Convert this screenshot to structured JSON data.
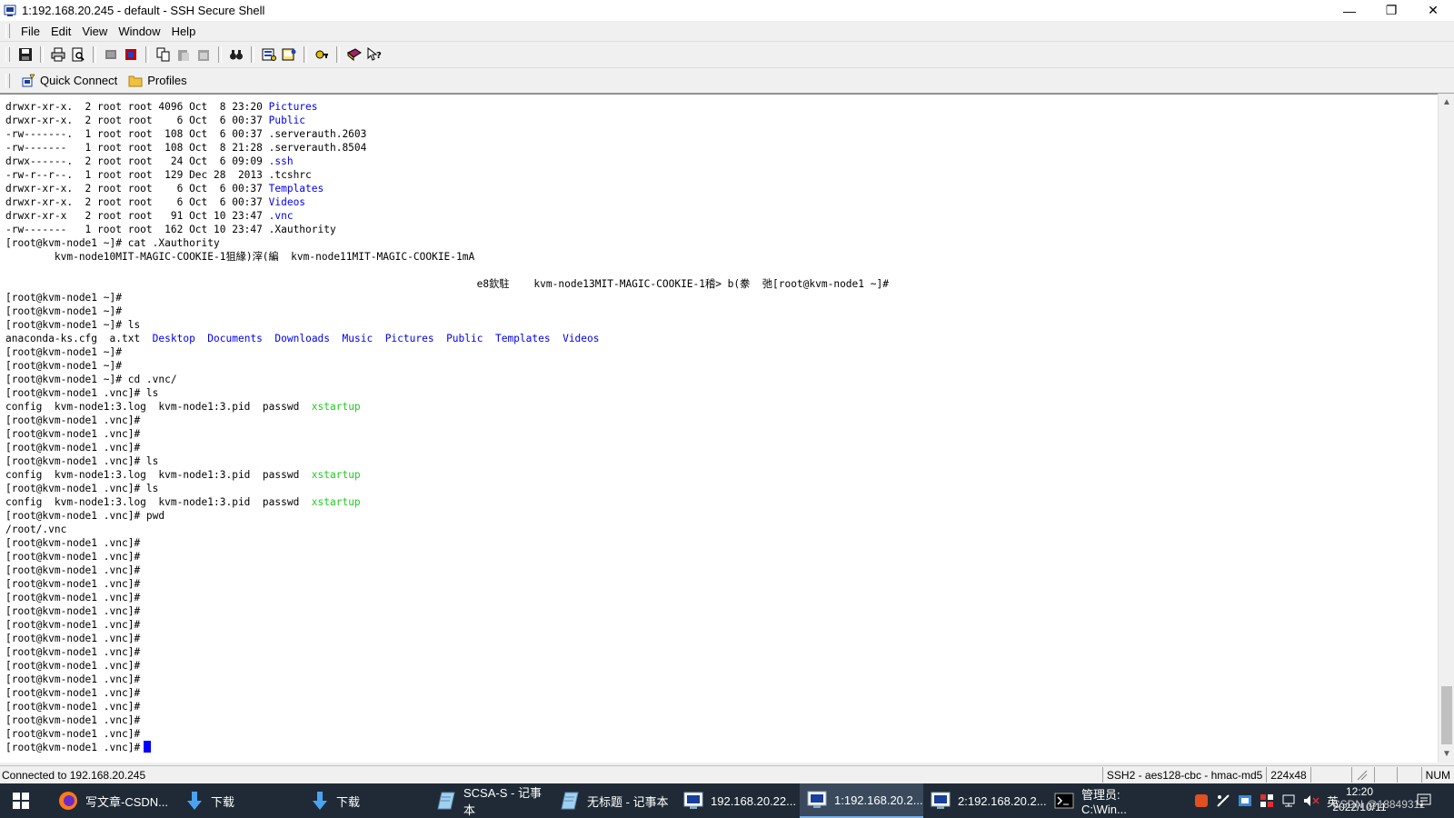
{
  "window": {
    "title": "1:192.168.20.245 - default - SSH Secure Shell",
    "controls": {
      "minimize": "—",
      "restore": "❐",
      "close": "✕"
    }
  },
  "menu": [
    {
      "label": "File",
      "icon": ""
    },
    {
      "label": "Edit"
    },
    {
      "label": "View"
    },
    {
      "label": "Window"
    },
    {
      "label": "Help"
    }
  ],
  "toolbar": {
    "buttons": [
      "save-icon",
      "print-icon",
      "print-preview-icon",
      "new-terminal-icon",
      "new-file-transfer-icon",
      "copy-icon",
      "paste-icon",
      "paste-special-icon",
      "find-icon",
      "settings-icon",
      "profile-icon",
      "keygen-icon",
      "help-book-icon",
      "whats-this-icon"
    ]
  },
  "quickbar": {
    "quick_connect": "Quick Connect",
    "profiles": "Profiles"
  },
  "terminal": {
    "lines": [
      [
        {
          "t": "drwxr-xr-x.  2 root root 4096 Oct  8 23:20 "
        },
        {
          "t": "Pictures",
          "c": "blue"
        }
      ],
      [
        {
          "t": "drwxr-xr-x.  2 root root    6 Oct  6 00:37 "
        },
        {
          "t": "Public",
          "c": "blue"
        }
      ],
      [
        {
          "t": "-rw-------.  1 root root  108 Oct  6 00:37 .serverauth.2603"
        }
      ],
      [
        {
          "t": "-rw-------   1 root root  108 Oct  8 21:28 .serverauth.8504"
        }
      ],
      [
        {
          "t": "drwx------.  2 root root   24 Oct  6 09:09 "
        },
        {
          "t": ".ssh",
          "c": "blue"
        }
      ],
      [
        {
          "t": "-rw-r--r--.  1 root root  129 Dec 28  2013 .tcshrc"
        }
      ],
      [
        {
          "t": "drwxr-xr-x.  2 root root    6 Oct  6 00:37 "
        },
        {
          "t": "Templates",
          "c": "blue"
        }
      ],
      [
        {
          "t": "drwxr-xr-x.  2 root root    6 Oct  6 00:37 "
        },
        {
          "t": "Videos",
          "c": "blue"
        }
      ],
      [
        {
          "t": "drwxr-xr-x   2 root root   91 Oct 10 23:47 "
        },
        {
          "t": ".vnc",
          "c": "blue"
        }
      ],
      [
        {
          "t": "-rw-------   1 root root  162 Oct 10 23:47 .Xauthority"
        }
      ],
      [
        {
          "t": "[root@kvm-node1 ~]# cat .Xauthority"
        }
      ],
      [
        {
          "t": "        kvm-node10MIT-MAGIC-COOKIE-1狙緣)滓(編  kvm-node11MIT-MAGIC-COOKIE-1mA"
        }
      ],
      [
        {
          "t": ""
        }
      ],
      [
        {
          "t": "                                                                             e8欽駐    kvm-node13MIT-MAGIC-COOKIE-1稽> b(豢  弛[root@kvm-node1 ~]#"
        }
      ],
      [
        {
          "t": "[root@kvm-node1 ~]#"
        }
      ],
      [
        {
          "t": "[root@kvm-node1 ~]#"
        }
      ],
      [
        {
          "t": "[root@kvm-node1 ~]# ls"
        }
      ],
      [
        {
          "t": "anaconda-ks.cfg  a.txt  "
        },
        {
          "t": "Desktop",
          "c": "blue"
        },
        {
          "t": "  "
        },
        {
          "t": "Documents",
          "c": "blue"
        },
        {
          "t": "  "
        },
        {
          "t": "Downloads",
          "c": "blue"
        },
        {
          "t": "  "
        },
        {
          "t": "Music",
          "c": "blue"
        },
        {
          "t": "  "
        },
        {
          "t": "Pictures",
          "c": "blue"
        },
        {
          "t": "  "
        },
        {
          "t": "Public",
          "c": "blue"
        },
        {
          "t": "  "
        },
        {
          "t": "Templates",
          "c": "blue"
        },
        {
          "t": "  "
        },
        {
          "t": "Videos",
          "c": "blue"
        }
      ],
      [
        {
          "t": "[root@kvm-node1 ~]#"
        }
      ],
      [
        {
          "t": "[root@kvm-node1 ~]#"
        }
      ],
      [
        {
          "t": "[root@kvm-node1 ~]# cd .vnc/"
        }
      ],
      [
        {
          "t": "[root@kvm-node1 .vnc]# ls"
        }
      ],
      [
        {
          "t": "config  kvm-node1:3.log  kvm-node1:3.pid  passwd  "
        },
        {
          "t": "xstartup",
          "c": "green"
        }
      ],
      [
        {
          "t": "[root@kvm-node1 .vnc]#"
        }
      ],
      [
        {
          "t": "[root@kvm-node1 .vnc]#"
        }
      ],
      [
        {
          "t": "[root@kvm-node1 .vnc]#"
        }
      ],
      [
        {
          "t": "[root@kvm-node1 .vnc]# ls"
        }
      ],
      [
        {
          "t": "config  kvm-node1:3.log  kvm-node1:3.pid  passwd  "
        },
        {
          "t": "xstartup",
          "c": "green"
        }
      ],
      [
        {
          "t": "[root@kvm-node1 .vnc]# ls"
        }
      ],
      [
        {
          "t": "config  kvm-node1:3.log  kvm-node1:3.pid  passwd  "
        },
        {
          "t": "xstartup",
          "c": "green"
        }
      ],
      [
        {
          "t": "[root@kvm-node1 .vnc]# pwd"
        }
      ],
      [
        {
          "t": "/root/.vnc"
        }
      ],
      [
        {
          "t": "[root@kvm-node1 .vnc]#"
        }
      ],
      [
        {
          "t": "[root@kvm-node1 .vnc]#"
        }
      ],
      [
        {
          "t": "[root@kvm-node1 .vnc]#"
        }
      ],
      [
        {
          "t": "[root@kvm-node1 .vnc]#"
        }
      ],
      [
        {
          "t": "[root@kvm-node1 .vnc]#"
        }
      ],
      [
        {
          "t": "[root@kvm-node1 .vnc]#"
        }
      ],
      [
        {
          "t": "[root@kvm-node1 .vnc]#"
        }
      ],
      [
        {
          "t": "[root@kvm-node1 .vnc]#"
        }
      ],
      [
        {
          "t": "[root@kvm-node1 .vnc]#"
        }
      ],
      [
        {
          "t": "[root@kvm-node1 .vnc]#"
        }
      ],
      [
        {
          "t": "[root@kvm-node1 .vnc]#"
        }
      ],
      [
        {
          "t": "[root@kvm-node1 .vnc]#"
        }
      ],
      [
        {
          "t": "[root@kvm-node1 .vnc]#"
        }
      ],
      [
        {
          "t": "[root@kvm-node1 .vnc]#"
        }
      ],
      [
        {
          "t": "[root@kvm-node1 .vnc]#"
        }
      ],
      [
        {
          "t": "[root@kvm-node1 .vnc]#",
          "cursor": true
        }
      ]
    ],
    "colors": {
      "blue": "#0000ee",
      "green": "#22cc22",
      "cursor": "#0000ff"
    }
  },
  "statusbar": {
    "connection": "Connected to 192.168.20.245",
    "cipher": "SSH2 - aes128-cbc - hmac-md5",
    "size": "224x48",
    "num": "NUM"
  },
  "taskbar": {
    "tasks": [
      {
        "label": "写文章-CSDN...",
        "icon": "firefox-icon"
      },
      {
        "label": "下载",
        "icon": "download-icon"
      },
      {
        "label": "下载",
        "icon": "download-icon"
      },
      {
        "label": "SCSA-S - 记事本",
        "icon": "notepad-icon"
      },
      {
        "label": "无标题 - 记事本",
        "icon": "notepad-icon"
      },
      {
        "label": "192.168.20.22...",
        "icon": "ssh-icon"
      },
      {
        "label": "1:192.168.20.2...",
        "icon": "ssh-icon",
        "active": true
      },
      {
        "label": "2:192.168.20.2...",
        "icon": "ssh-icon"
      },
      {
        "label": "管理员: C:\\Win...",
        "icon": "cmd-icon"
      }
    ],
    "ime": "英",
    "time": "12:20",
    "date": "2022/10/11",
    "watermark": "CSDN @18849311"
  }
}
